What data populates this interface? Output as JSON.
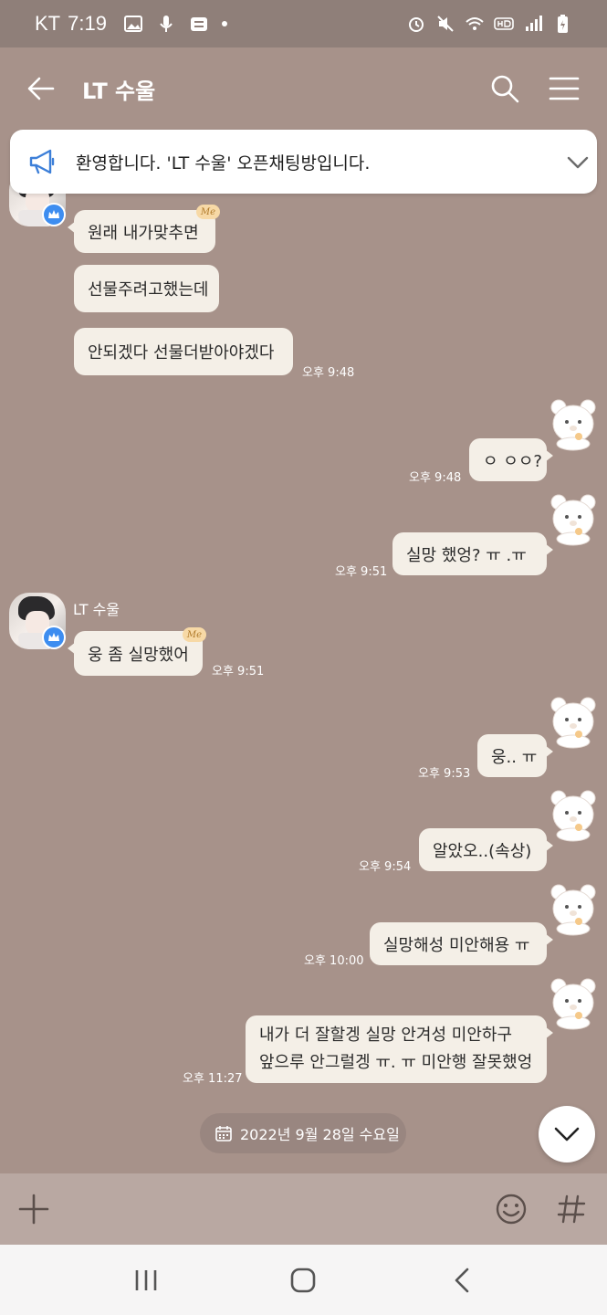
{
  "status_bar": {
    "carrier": "KT",
    "time": "7:19"
  },
  "header": {
    "title": "LT 수울"
  },
  "notice": {
    "text": "환영합니다. 'LT 수울' 오픈채팅방입니다."
  },
  "sticker_badge": "Me",
  "messages": {
    "m1": {
      "text": "원래 내가맞추면"
    },
    "m2": {
      "text": "선물주려고했는데"
    },
    "m3": {
      "text": "안되겠다 선물더받아야겠다",
      "time": "오후 9:48"
    },
    "m4": {
      "text": "ㅇ ㅇㅇ?",
      "time": "오후 9:48"
    },
    "m5": {
      "text": "실망 했엉?  ㅠ .ㅠ",
      "time": "오후 9:51"
    },
    "m6": {
      "sender": "LT 수울",
      "text": "웅 좀 실망했어",
      "time": "오후 9:51"
    },
    "m7": {
      "text": "웅.. ㅠ",
      "time": "오후 9:53"
    },
    "m8": {
      "text": "알았오..(속상)",
      "time": "오후 9:54"
    },
    "m9": {
      "text": "실망해성 미안해용 ㅠ",
      "time": "오후 10:00"
    },
    "m10": {
      "line1": "내가 더 잘할겡 실망 안겨성 미안하구",
      "line2": "앞으루 안그럴겡 ㅠ. ㅠ 미안행 잘못했엉",
      "time": "오후 11:27"
    }
  },
  "date_divider": "2022년 9월 28일 수요일",
  "colors": {
    "chat_background": "#a7928a",
    "bubble": "#f4efe7",
    "status_bar": "#8f7f79",
    "input_bar": "#b9a8a2",
    "badge_blue": "#3d8df0"
  }
}
